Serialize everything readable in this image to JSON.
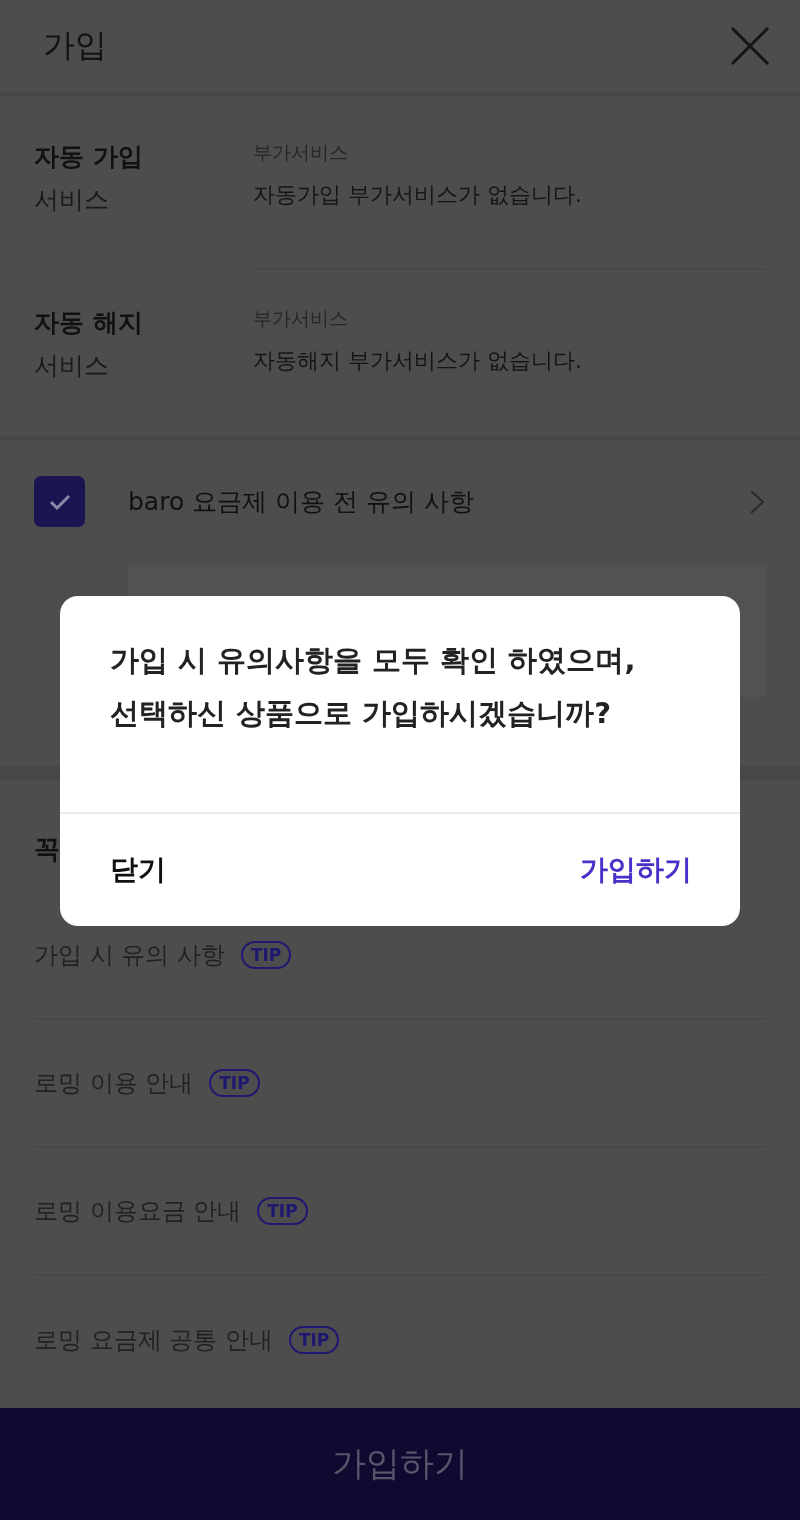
{
  "header": {
    "title": "가입"
  },
  "services": [
    {
      "title": "자동 가입",
      "subtitle": "서비스",
      "caption": "부가서비스",
      "value": "자동가입 부가서비스가 없습니다."
    },
    {
      "title": "자동 해지",
      "subtitle": "서비스",
      "caption": "부가서비스",
      "value": "자동해지 부가서비스가 없습니다."
    }
  ],
  "agreement": {
    "label": "baro 요금제 이용 전 유의 사항",
    "checked": true
  },
  "notices": {
    "heading": "꼭",
    "items": [
      {
        "label": "가입 시 유의 사항",
        "badge": "TIP"
      },
      {
        "label": "로밍 이용 안내",
        "badge": "TIP"
      },
      {
        "label": "로밍 이용요금 안내",
        "badge": "TIP"
      },
      {
        "label": "로밍 요금제 공통 안내",
        "badge": "TIP"
      }
    ]
  },
  "footer_button": "가입하기",
  "dialog": {
    "message_lines": [
      "가입 시 유의사항을 모두 확인 하였으며,",
      "선택하신 상품으로 가입하시겠습니까?"
    ],
    "buttons": [
      {
        "label": "닫기",
        "kind": "plain"
      },
      {
        "label": "가입하기",
        "kind": "primary"
      }
    ]
  }
}
